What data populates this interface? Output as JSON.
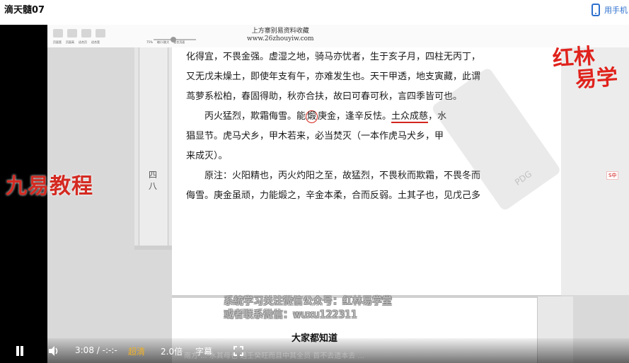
{
  "header": {
    "title": "滴天髓07",
    "phone_label": "用手机"
  },
  "doc": {
    "site_watermark_1": "上方寨别易资料收藏",
    "site_watermark_2": "www.26zhouyiw.com",
    "toolbar_labels": [
      "页面宽",
      "页面高",
      "适合页",
      "适合宽",
      "75%",
      "缩小/放大",
      "适合页面"
    ],
    "page_number": [
      "四",
      "八"
    ],
    "lines": [
      "化得宜，不畏金强。虚湿之地，骑马亦忧者，生于亥子月，四柱无丙丁，",
      "又无戊未燥土，即使年支有午，亦难发生也。天干甲透，地支寅藏，此谓",
      "茑萝系松柏，春固得助，秋亦合扶，故曰可春可秋，言四季皆可也。"
    ],
    "verse_pre": "丙火猛烈，欺霜侮雪。能",
    "verse_circled": "煅",
    "verse_mid": "庚金，逢辛反怯。",
    "verse_underlined": "土众成慈",
    "verse_post": "，水",
    "verse_line2": "猖显节。虎马犬乡，甲木若来，必当焚灭（一本作虎马犬乡，甲",
    "verse_line3": "来成灭）。",
    "note_line1": "原注：火阳精也，丙火灼阳之至，故猛烈，不畏秋而欺霜，不畏冬而",
    "note_line2": "侮雪。庚金虽顽，力能煅之，辛金本柔，合而反弱。土其子也，见戊己多",
    "stamp_text": "PDG"
  },
  "watermarks": {
    "brand_left": "九易教程",
    "logo_line1": "红林",
    "logo_line2": "易学",
    "overlay_line1": "系统学习关注微信公众号：红林易学堂",
    "overlay_line2": "或者联系微信：wuxu122311",
    "small_badge": "S中"
  },
  "player": {
    "subtitle": "大家都知道",
    "time": "3:08 / -:-:-",
    "quality": "超清",
    "speed": "2.0倍",
    "caption": "字幕",
    "bottom_bg_text": "南方 ... 水其母也 遇壬癸旺而且中其全员 首不去遗本去 ..."
  },
  "colors": {
    "accent": "#2b6fce",
    "quality": "#f0b128",
    "watermark_red": "#d42a22"
  }
}
